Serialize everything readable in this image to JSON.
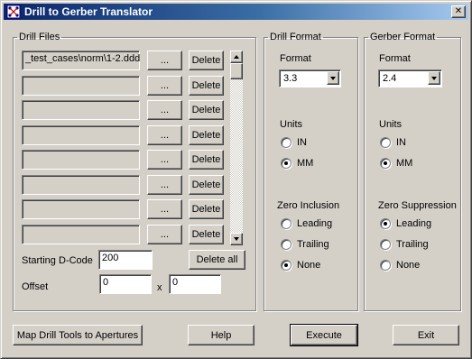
{
  "window": {
    "title": "Drill to Gerber Translator",
    "close_glyph": "✕"
  },
  "drill_files": {
    "legend": "Drill Files",
    "browse_label": "...",
    "delete_label": "Delete",
    "files": [
      "_test_cases\\norm\\1-2.ddd",
      "",
      "",
      "",
      "",
      "",
      "",
      ""
    ],
    "starting_dcode_label": "Starting D-Code",
    "starting_dcode_value": "200",
    "delete_all_label": "Delete all",
    "offset_label": "Offset",
    "offset_x": "0",
    "offset_sep": "x",
    "offset_y": "0"
  },
  "drill_format": {
    "legend": "Drill Format",
    "format_label": "Format",
    "format_value": "3.3",
    "units_label": "Units",
    "units": [
      {
        "label": "IN",
        "checked": false
      },
      {
        "label": "MM",
        "checked": true
      }
    ],
    "zero_label": "Zero Inclusion",
    "zero_options": [
      {
        "label": "Leading",
        "checked": false
      },
      {
        "label": "Trailing",
        "checked": false
      },
      {
        "label": "None",
        "checked": true
      }
    ]
  },
  "gerber_format": {
    "legend": "Gerber Format",
    "format_label": "Format",
    "format_value": "2.4",
    "units_label": "Units",
    "units": [
      {
        "label": "IN",
        "checked": false
      },
      {
        "label": "MM",
        "checked": true
      }
    ],
    "zero_label": "Zero Suppression",
    "zero_options": [
      {
        "label": "Leading",
        "checked": true
      },
      {
        "label": "Trailing",
        "checked": false
      },
      {
        "label": "None",
        "checked": false
      }
    ]
  },
  "footer": {
    "map_label": "Map Drill Tools to Apertures",
    "help_label": "Help",
    "execute_label": "Execute",
    "exit_label": "Exit"
  },
  "colors": {
    "face": "#d4d0c8",
    "title_start": "#0a246a",
    "title_end": "#a6caf0"
  },
  "icons": {
    "app": "pcb-app-icon",
    "close": "close-icon"
  }
}
